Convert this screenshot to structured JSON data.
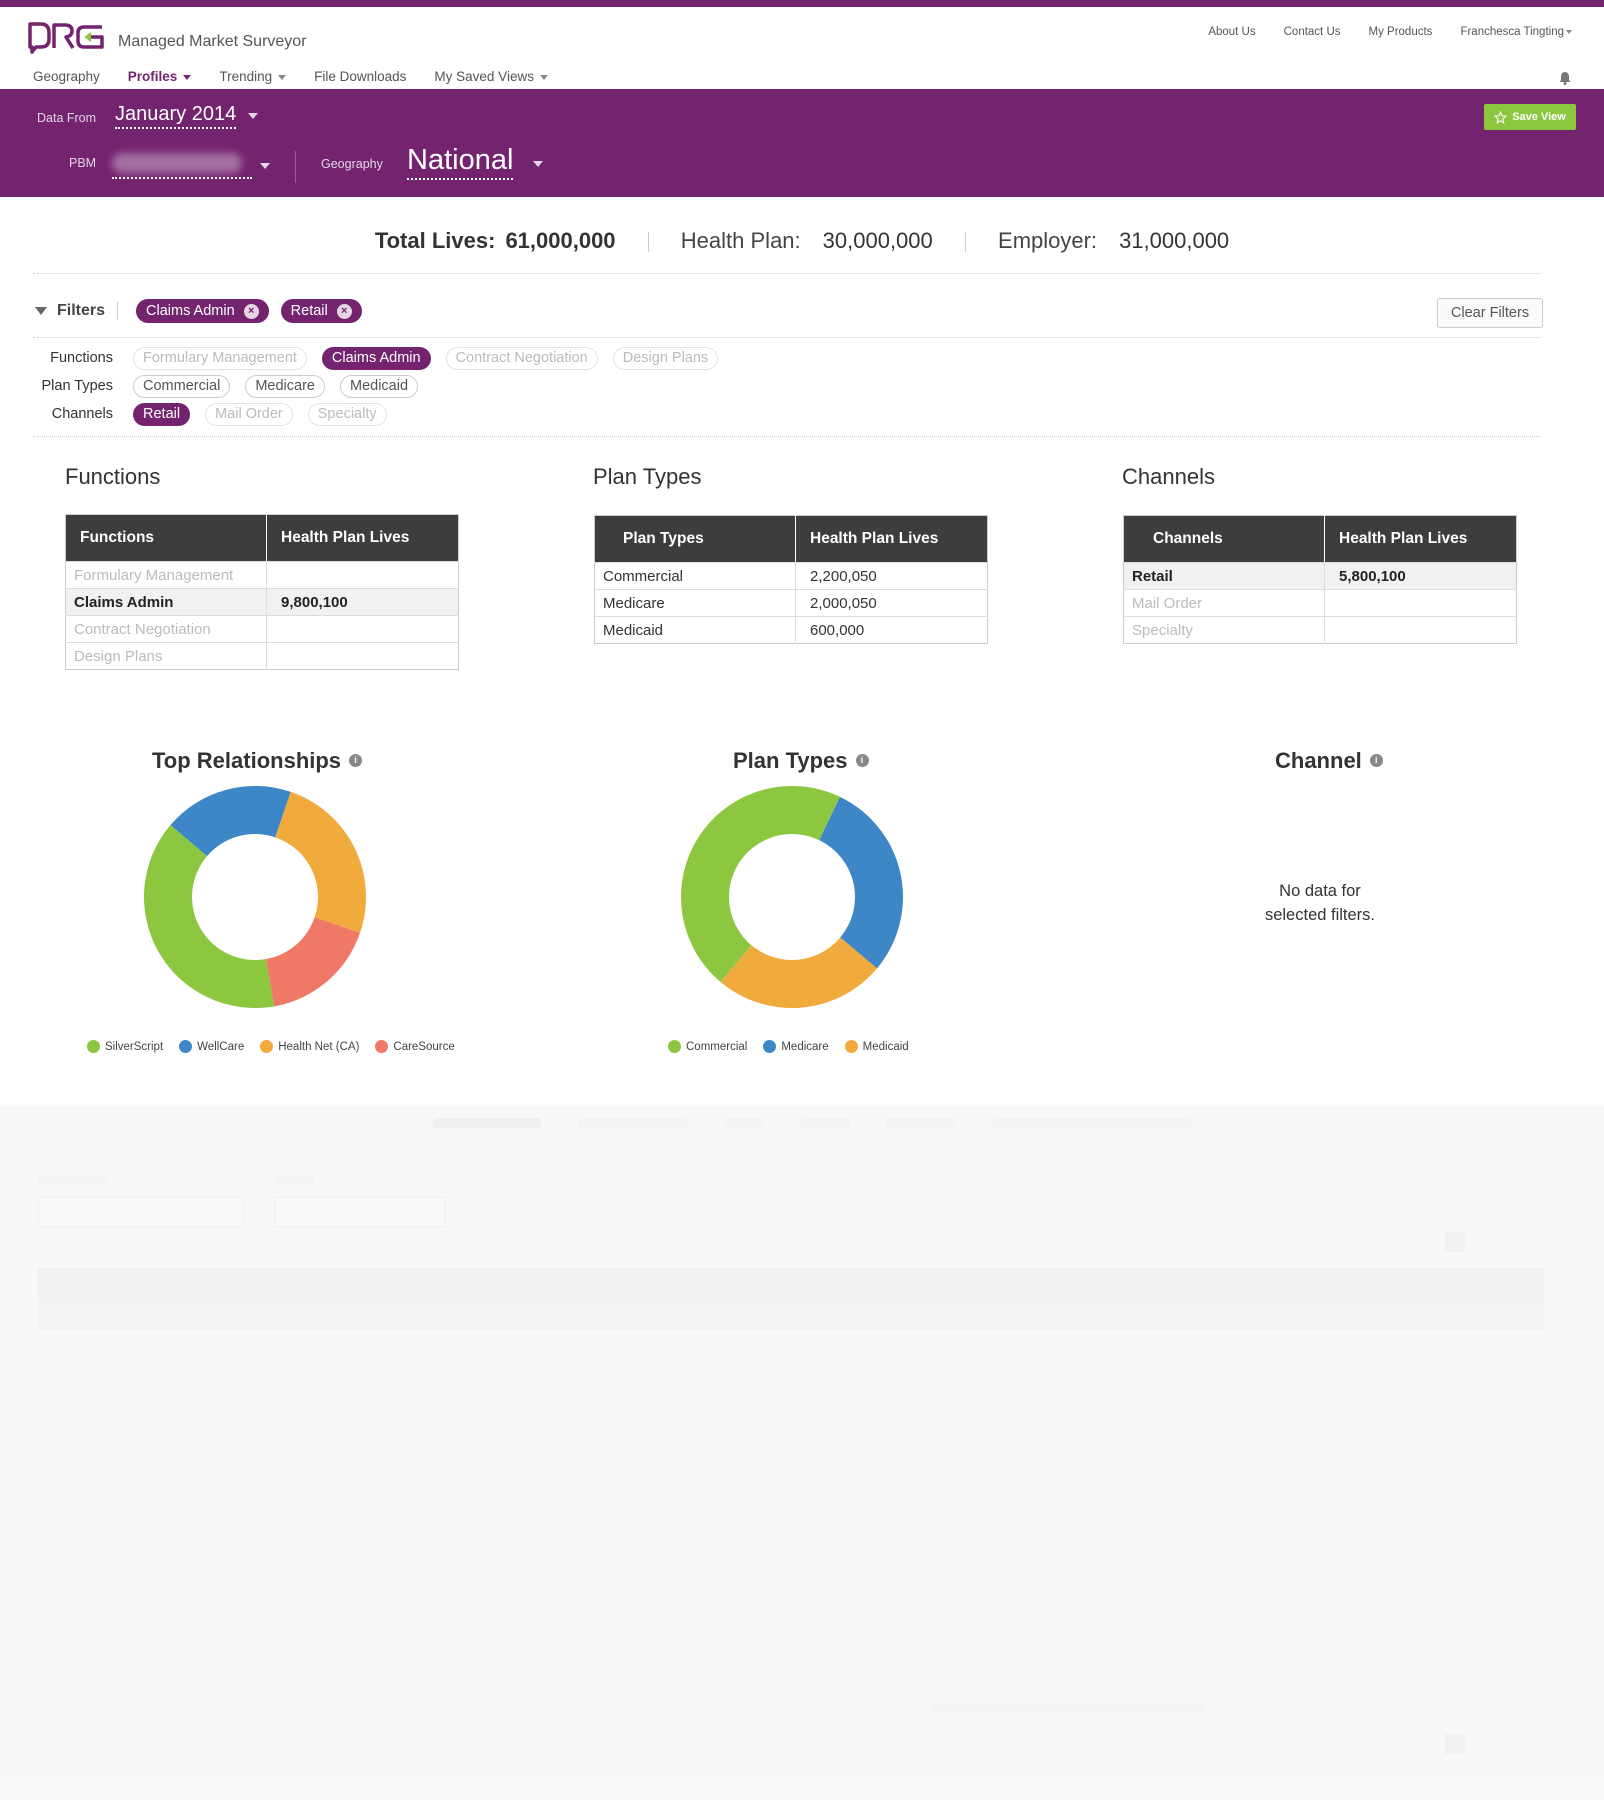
{
  "app": {
    "logo_text": "DRG",
    "title": "Managed Market Surveyor"
  },
  "utility_nav": [
    "About Us",
    "Contact Us",
    "My Products",
    "Franchesca Tingting"
  ],
  "main_nav": [
    {
      "label": "Geography",
      "dropdown": false,
      "active": false
    },
    {
      "label": "Profiles",
      "dropdown": true,
      "active": true
    },
    {
      "label": "Trending",
      "dropdown": true,
      "active": false
    },
    {
      "label": "File Downloads",
      "dropdown": false,
      "active": false
    },
    {
      "label": "My Saved Views",
      "dropdown": true,
      "active": false
    }
  ],
  "context": {
    "data_from_label": "Data From",
    "data_from_value": "January 2014",
    "pbm_label": "PBM",
    "geography_label": "Geography",
    "geography_value": "National",
    "save_view_label": "Save View"
  },
  "totals": {
    "total_label": "Total Lives:",
    "total_value": "61,000,000",
    "health_plan_label": "Health Plan:",
    "health_plan_value": "30,000,000",
    "employer_label": "Employer:",
    "employer_value": "31,000,000"
  },
  "filters": {
    "label": "Filters",
    "active": [
      "Claims Admin",
      "Retail"
    ],
    "clear_label": "Clear Filters",
    "groups": [
      {
        "label": "Functions",
        "options": [
          {
            "label": "Formulary Management",
            "state": "off"
          },
          {
            "label": "Claims Admin",
            "state": "on"
          },
          {
            "label": "Contract Negotiation",
            "state": "off"
          },
          {
            "label": "Design Plans",
            "state": "off"
          }
        ]
      },
      {
        "label": "Plan Types",
        "options": [
          {
            "label": "Commercial",
            "state": "mid"
          },
          {
            "label": "Medicare",
            "state": "mid"
          },
          {
            "label": "Medicaid",
            "state": "mid"
          }
        ]
      },
      {
        "label": "Channels",
        "options": [
          {
            "label": "Retail",
            "state": "on"
          },
          {
            "label": "Mail Order",
            "state": "off"
          },
          {
            "label": "Specialty",
            "state": "off"
          }
        ]
      }
    ]
  },
  "tables": {
    "functions": {
      "title": "Functions",
      "headers": [
        "Functions",
        "Health Plan Lives"
      ],
      "rows": [
        {
          "name": "Formulary Management",
          "value": "",
          "state": "dim"
        },
        {
          "name": "Claims Admin",
          "value": "9,800,100",
          "state": "sel"
        },
        {
          "name": "Contract Negotiation",
          "value": "",
          "state": "dim"
        },
        {
          "name": "Design Plans",
          "value": "",
          "state": "dim"
        }
      ]
    },
    "plan_types": {
      "title": "Plan Types",
      "headers": [
        "Plan Types",
        "Health Plan Lives"
      ],
      "rows": [
        {
          "name": "Commercial",
          "value": "2,200,050",
          "state": "normal"
        },
        {
          "name": "Medicare",
          "value": "2,000,050",
          "state": "normal"
        },
        {
          "name": "Medicaid",
          "value": "600,000",
          "state": "normal"
        }
      ]
    },
    "channels": {
      "title": "Channels",
      "headers": [
        "Channels",
        "Health Plan Lives"
      ],
      "rows": [
        {
          "name": "Retail",
          "value": "5,800,100",
          "state": "sel"
        },
        {
          "name": "Mail Order",
          "value": "",
          "state": "dim"
        },
        {
          "name": "Specialty",
          "value": "",
          "state": "dim"
        }
      ]
    }
  },
  "charts": {
    "relationships_title": "Top Relationships",
    "plan_types_title": "Plan Types",
    "channel_title": "Channel",
    "no_data_line1": "No data for",
    "no_data_line2": "selected filters."
  },
  "chart_data": [
    {
      "type": "pie",
      "title": "Top Relationships",
      "categories": [
        "SilverScript",
        "WellCare",
        "Health Net (CA)",
        "CareSource"
      ],
      "values": [
        39,
        19,
        25,
        17
      ],
      "colors": [
        "#8dc63f",
        "#3d87c7",
        "#f1ab3d",
        "#ef7866"
      ]
    },
    {
      "type": "pie",
      "title": "Plan Types",
      "categories": [
        "Commercial",
        "Medicare",
        "Medicaid"
      ],
      "values": [
        46,
        29,
        25
      ],
      "colors": [
        "#8dc63f",
        "#3d87c7",
        "#f1ab3d"
      ]
    }
  ],
  "colors": {
    "brand_purple": "#74236f",
    "accent_green": "#8dc63f"
  }
}
